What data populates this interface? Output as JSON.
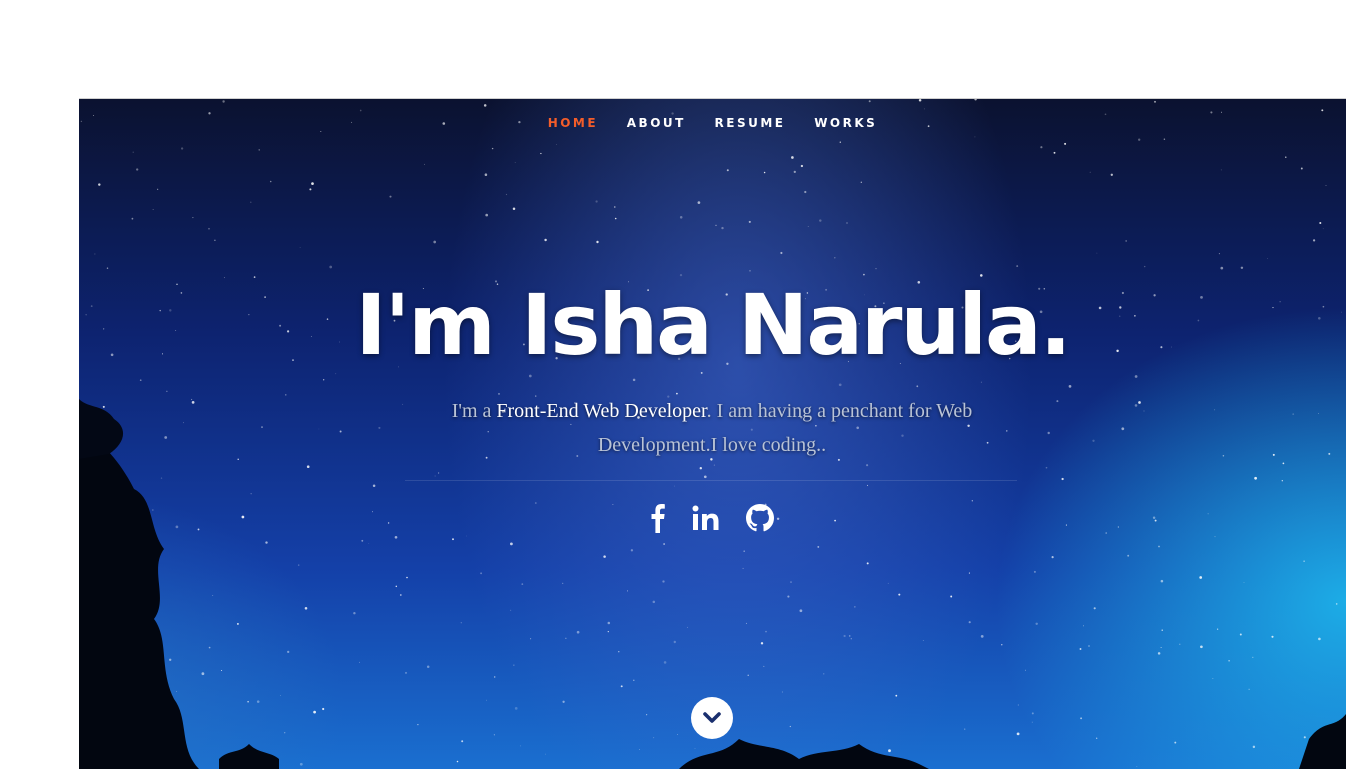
{
  "nav": {
    "items": [
      {
        "label": "HOME",
        "active": true
      },
      {
        "label": "ABOUT",
        "active": false
      },
      {
        "label": "RESUME",
        "active": false
      },
      {
        "label": "WORKS",
        "active": false
      }
    ]
  },
  "hero": {
    "title": "I'm Isha Narula.",
    "intro_prefix": "I'm a ",
    "intro_highlight": "Front-End Web Developer",
    "intro_suffix": ". I am having a penchant for Web Development.I love coding.."
  },
  "social": [
    "facebook-icon",
    "linkedin-icon",
    "github-icon"
  ],
  "colors": {
    "accent": "#f35d2a",
    "text": "#ffffff",
    "muted": "#b9c3d6"
  }
}
